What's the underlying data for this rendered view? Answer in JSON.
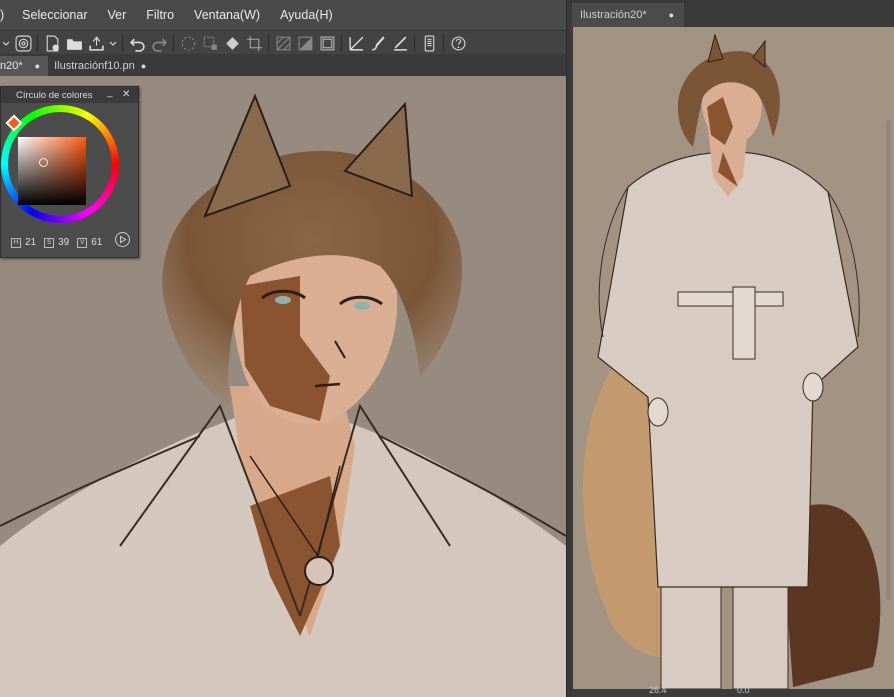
{
  "menu": {
    "items": [
      ")",
      "Seleccionar",
      "Ver",
      "Filtro",
      "Ventana(W)",
      "Ayuda(H)"
    ]
  },
  "toolbar": {
    "icons": [
      "spiral-icon",
      "new-file-icon",
      "open-folder-icon",
      "export-icon",
      "undo-icon",
      "redo-icon",
      "magic-wand-icon",
      "select-transform-icon",
      "fill-icon",
      "crop-icon",
      "hatch-icon",
      "half-tone-icon",
      "frame-icon",
      "ruler-icon",
      "brush-icon",
      "ruler-pen-icon",
      "smartphone-icon",
      "help-icon"
    ]
  },
  "left_tabs": [
    {
      "label": "n20*",
      "modified": "●"
    },
    {
      "label": "Ilustraciónf10.pn",
      "modified": "●"
    }
  ],
  "right_tabs": [
    {
      "label": "Ilustración20*",
      "modified": "●"
    }
  ],
  "color_panel": {
    "title": "Círculo de colores",
    "minimize": "_",
    "close": "✕",
    "h_label": "H",
    "h": "21",
    "s_label": "S",
    "s": "39",
    "v_label": "V",
    "v": "61",
    "accent": "#ff5a10"
  },
  "status_right": {
    "zoom": "26.4",
    "rotation": "0.0"
  },
  "colors": {
    "canvas_left_bg": "#978b7f",
    "canvas_right_bg": "#a29382",
    "hair": "#7a5a3c",
    "skin": "#d3a083",
    "shirt": "#d3c9c0"
  }
}
